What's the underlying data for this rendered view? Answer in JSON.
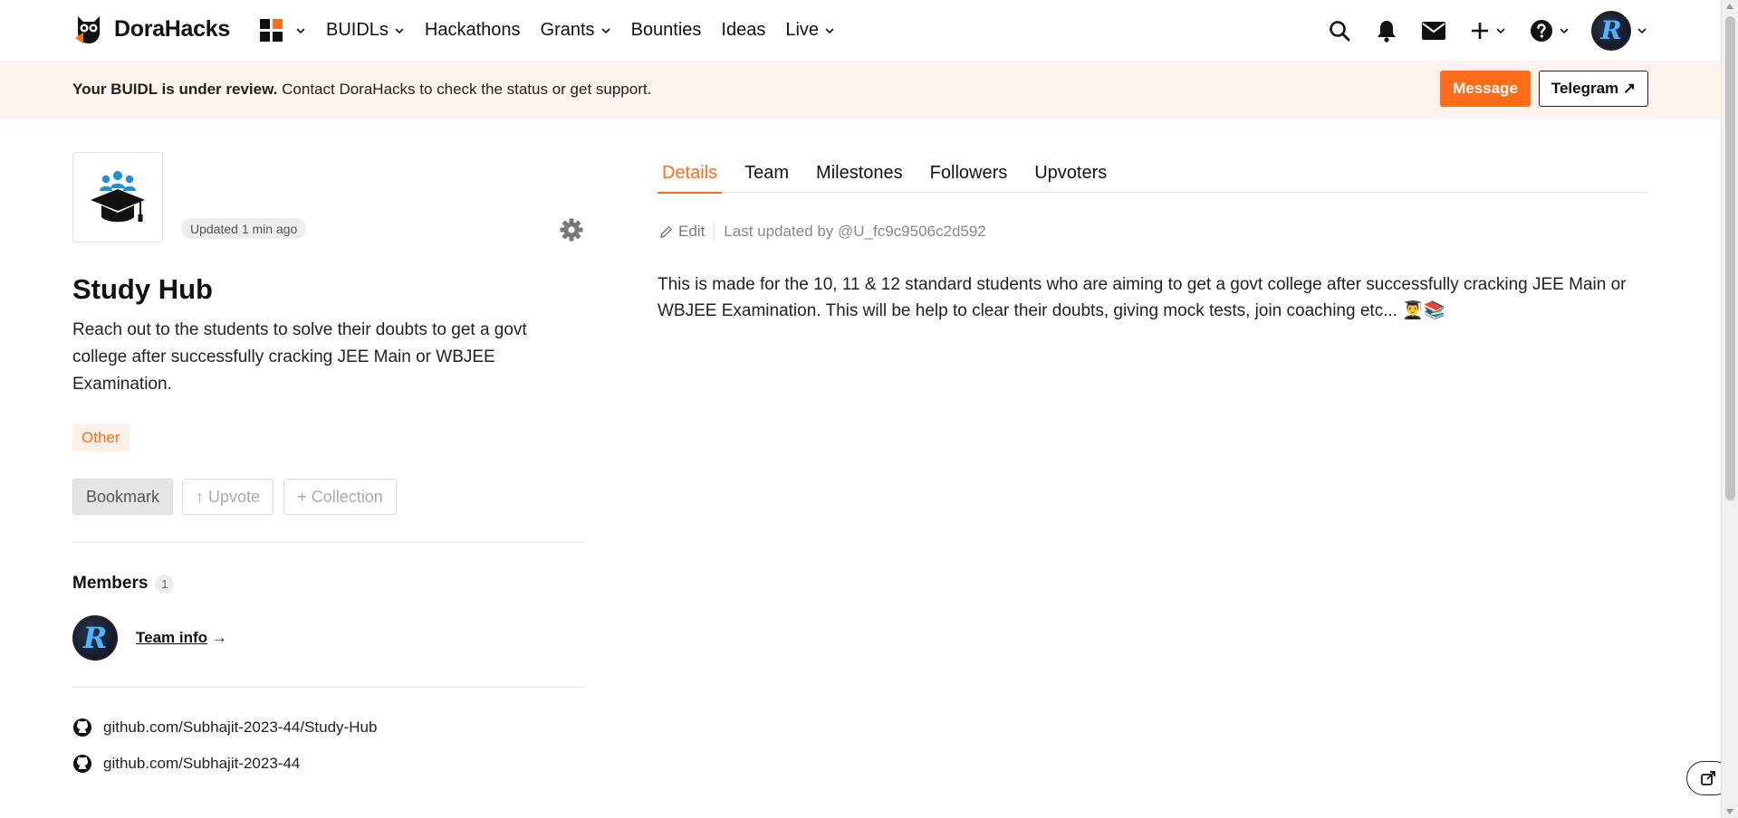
{
  "brand": {
    "name": "DoraHacks",
    "accent": "#ff6d1a"
  },
  "nav": {
    "items": [
      {
        "label": "BUIDLs",
        "dropdown": true
      },
      {
        "label": "Hackathons",
        "dropdown": false
      },
      {
        "label": "Grants",
        "dropdown": true
      },
      {
        "label": "Bounties",
        "dropdown": false
      },
      {
        "label": "Ideas",
        "dropdown": false
      },
      {
        "label": "Live",
        "dropdown": true
      }
    ],
    "right_icons": [
      "search-icon",
      "bell-icon",
      "mail-icon",
      "plus-icon",
      "help-icon",
      "avatar"
    ]
  },
  "banner": {
    "bold": "Your BUIDL is under review.",
    "text": " Contact DoraHacks to check the status or get support.",
    "message_label": "Message",
    "telegram_label": "Telegram ↗"
  },
  "project": {
    "updated": "Updated 1 min ago",
    "title": "Study Hub",
    "description": "Reach out to the students to solve their doubts to get a govt college after successfully cracking JEE Main or WBJEE Examination.",
    "tag": "Other",
    "actions": {
      "bookmark": "Bookmark",
      "upvote": "↑ Upvote",
      "collection": "+ Collection"
    },
    "members_title": "Members",
    "members_count": "1",
    "team_info_label": "Team info",
    "team_info_arrow": " →",
    "links": [
      "github.com/Subhajit-2023-44/Study-Hub",
      "github.com/Subhajit-2023-44"
    ]
  },
  "tabs": [
    "Details",
    "Team",
    "Milestones",
    "Followers",
    "Upvoters"
  ],
  "details": {
    "edit_label": "Edit",
    "last_updated": "Last updated by @U_fc9c9506c2d592",
    "body": "This is made for the 10, 11 & 12 standard students who are aiming to get a govt college after successfully cracking JEE Main or WBJEE Examination. This will be help to clear their doubts, giving mock tests, join coaching etc... 👨‍🎓📚"
  }
}
